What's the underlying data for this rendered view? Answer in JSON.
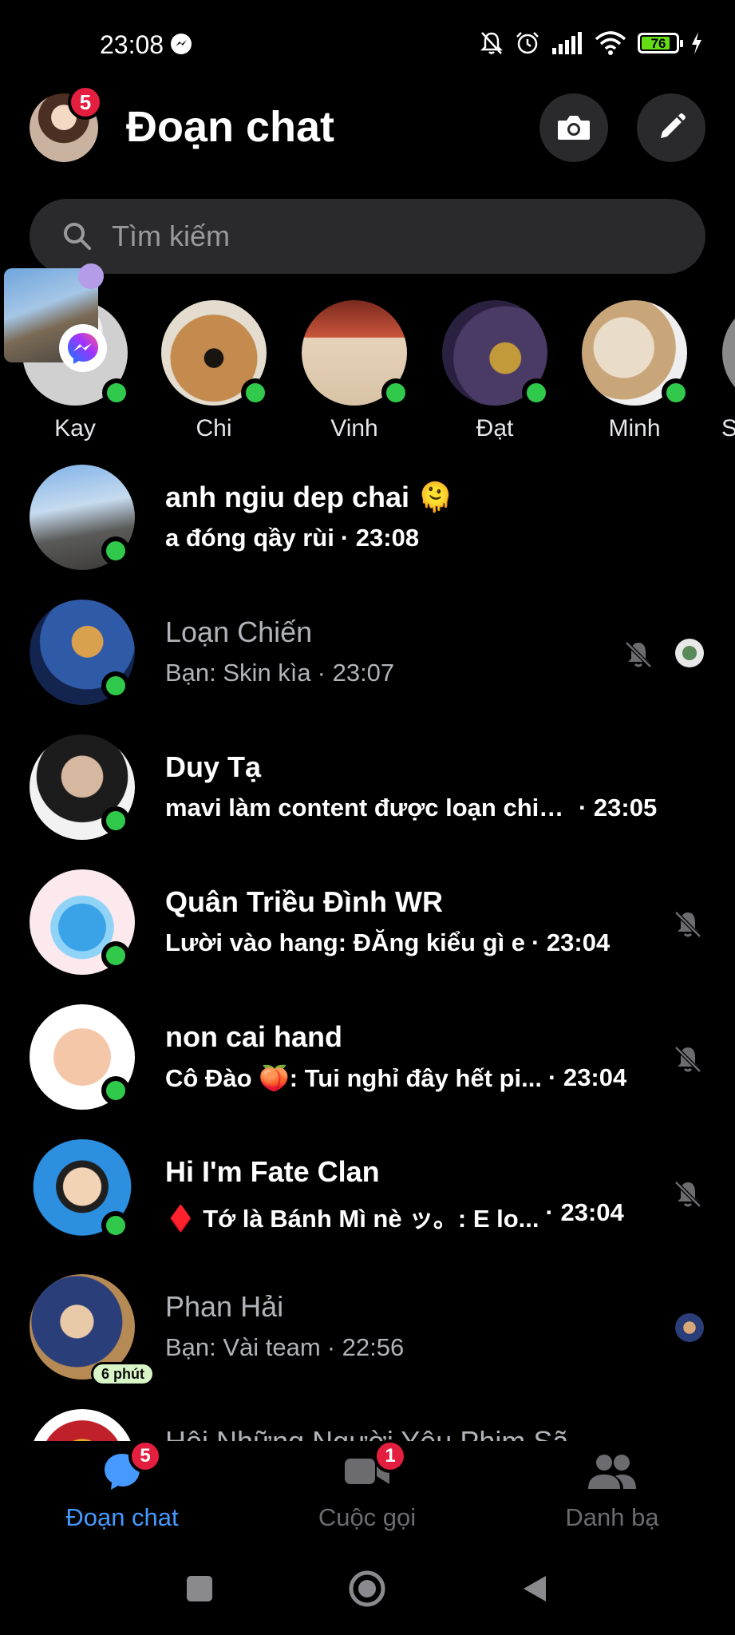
{
  "status_bar": {
    "time": "23:08",
    "battery": "76",
    "battery_color": "#64dd17",
    "icons": [
      "messenger-icon",
      "bell-off-icon",
      "alarm-icon",
      "signal-icon",
      "wifi-icon",
      "battery-icon",
      "charging-icon"
    ]
  },
  "header": {
    "title": "Đoạn chat",
    "profile_badge": "5",
    "camera_icon": "camera-icon",
    "compose_icon": "pencil-icon"
  },
  "search": {
    "placeholder": "Tìm kiếm"
  },
  "stories": [
    {
      "name": "Kay"
    },
    {
      "name": "Chi"
    },
    {
      "name": "Vinh"
    },
    {
      "name": "Đạt"
    },
    {
      "name": "Minh"
    },
    {
      "name": "S"
    }
  ],
  "chats": [
    {
      "name": "anh ngiu dep chai 🫠",
      "preview": "a đóng qầy rùi",
      "time": "· 23:08",
      "state": "unread",
      "online": true
    },
    {
      "name": "Loạn Chiến",
      "preview": "Bạn: Skin kìa",
      "time": "· 23:07",
      "state": "read",
      "online": true,
      "muted": true,
      "seen": true
    },
    {
      "name": "Duy Tạ",
      "preview": "mavi làm content được loạn chie...",
      "time": "· 23:05",
      "state": "unread",
      "online": true
    },
    {
      "name": "Quân Triều Đình WR",
      "preview": "Lười vào hang: ĐĂng kiểu gì e",
      "time": "· 23:04",
      "state": "unread",
      "online": true,
      "muted": true
    },
    {
      "name": "non cai hand",
      "preview": "Cô Đào 🍑: Tui nghỉ đây hết pi...",
      "time": "· 23:04",
      "state": "unread",
      "online": true,
      "muted": true
    },
    {
      "name": "Hi I'm Fate Clan",
      "preview": "♦️ Tớ là Bánh Mì nè ッ。: E lo...",
      "time": "· 23:04",
      "state": "unread",
      "online": true,
      "muted": true
    },
    {
      "name": "Phan Hải",
      "preview": "Bạn: Vài team",
      "time": "· 22:56",
      "state": "read",
      "active_badge": "6 phút",
      "seen": true
    },
    {
      "name": "Hội Những Người Yêu Phim Sã",
      "preview": "",
      "time": "",
      "state": "read"
    }
  ],
  "tabs": [
    {
      "label": "Đoạn chat",
      "badge": "5",
      "active": true
    },
    {
      "label": "Cuộc gọi",
      "badge": "1",
      "active": false
    },
    {
      "label": "Danh bạ",
      "badge": "",
      "active": false
    }
  ],
  "colors": {
    "accent": "#4599ff",
    "online": "#31c94c",
    "badge": "#e41e3f"
  }
}
